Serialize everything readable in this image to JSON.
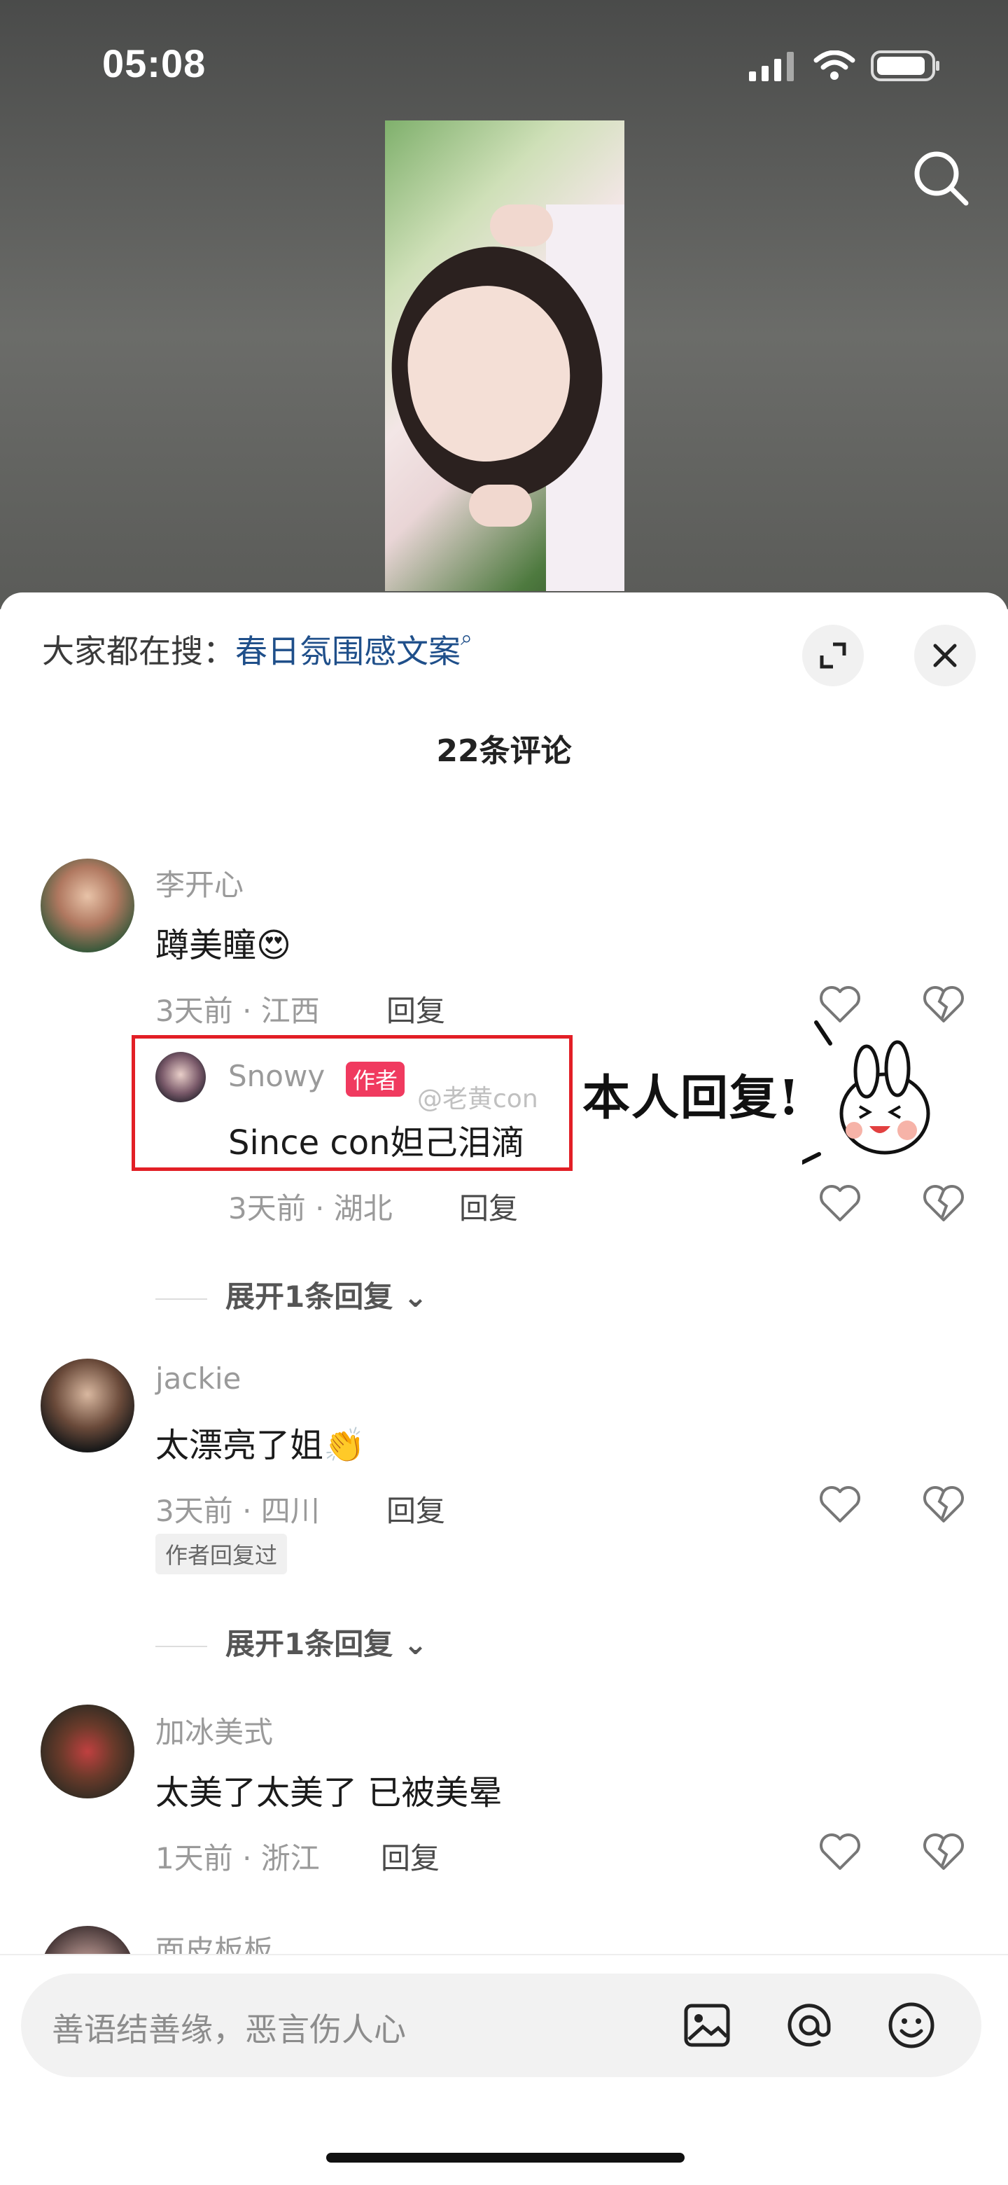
{
  "status_bar": {
    "time": "05:08"
  },
  "sheet": {
    "hot_search_label": "大家都在搜：",
    "hot_search_value": "春日氛围感文案",
    "comment_count": "22条评论"
  },
  "comments": [
    {
      "username": "李开心",
      "text": "蹲美瞳",
      "emoji": "😍",
      "meta": "3天前 · 江西",
      "reply_label": "回复",
      "reply": {
        "username": "Snowy",
        "badge": "作者",
        "text": "Since con妲己泪滴",
        "meta": "3天前 · 湖北",
        "reply_label": "回复"
      },
      "expand": "展开1条回复"
    },
    {
      "username": "jackie",
      "text": "太漂亮了姐",
      "emoji": "👏",
      "meta": "3天前 · 四川",
      "reply_label": "回复",
      "tag": "作者回复过",
      "expand": "展开1条回复"
    },
    {
      "username": "加冰美式",
      "text": "太美了太美了 已被美晕",
      "meta": "1天前 · 浙江",
      "reply_label": "回复"
    },
    {
      "username": "面皮板板"
    }
  ],
  "annotation": {
    "handwritten": "本人回复!",
    "watermark": "@老黄con"
  },
  "input": {
    "placeholder": "善语结善缘，恶言伤人心"
  },
  "colors": {
    "accent_link": "#1f4f8a",
    "author_badge": "#f03a5f",
    "highlight_box": "#e21f26"
  },
  "icons": [
    "search-icon",
    "expand-icon",
    "close-icon",
    "heart-icon",
    "dislike-icon",
    "image-icon",
    "at-icon",
    "emoji-icon"
  ]
}
